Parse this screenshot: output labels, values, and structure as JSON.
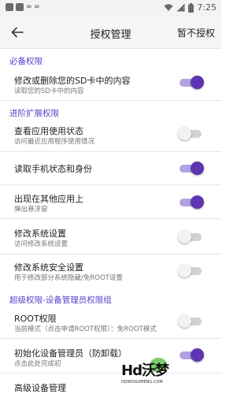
{
  "status_bar": {
    "left_icons": [
      "app-square-icon",
      "app-square-icon",
      "link-icon",
      "link-icon"
    ],
    "link_glyph": "∞",
    "time": "7:25"
  },
  "app_bar": {
    "title": "授权管理",
    "action": "暂不授权"
  },
  "sections": [
    {
      "label": "必备权限"
    },
    {
      "label": "进阶扩展权限"
    },
    {
      "label": "超级权限-设备管理员权限组"
    }
  ],
  "items": [
    {
      "title": "修改或删除您的SD卡中的内容",
      "subtitle": "读取您的SD卡中的内容",
      "toggle": true
    },
    {
      "title": "查看应用使用状态",
      "subtitle": "访问最近应用程序使用情况",
      "toggle": false
    },
    {
      "title": "读取手机状态和身份",
      "subtitle": "",
      "toggle": true
    },
    {
      "title": "出现在其他应用上",
      "subtitle": "弹出悬浮窗",
      "toggle": true
    },
    {
      "title": "修改系统设置",
      "subtitle": "访问修改系统设置",
      "toggle": false
    },
    {
      "title": "修改系统安全设置",
      "subtitle": "用于修改部分系统隐藏/免ROOT设置",
      "toggle": false
    },
    {
      "title": "ROOT权限",
      "subtitle": "当前模式（点击申请ROOT权限）：免ROOT模式",
      "toggle": false
    },
    {
      "title": "初始化设备管理员（防卸载）",
      "subtitle": "点击此处完成初",
      "toggle": true
    },
    {
      "title": "高级设备管理",
      "subtitle": "",
      "toggle": null
    }
  ],
  "watermark": {
    "text": "Hd沃梦",
    "subtext": "HDWOGOMENG.COM"
  },
  "colors": {
    "accent": "#5b3fc8",
    "toggle_on": "#5e35b1",
    "toggle_off": "#f2f2f2"
  }
}
